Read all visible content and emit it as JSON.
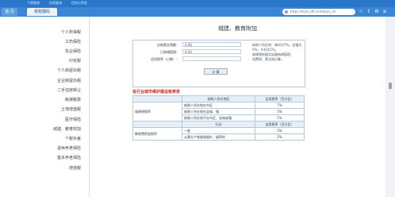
{
  "topbar": {
    "menu": [
      "个税查询",
      "社保查询",
      "住房公积金"
    ]
  },
  "tabs": {
    "home": "首 页",
    "active": "报税器码"
  },
  "address": {
    "text": "https://bszs.yffi.com/bszs_sh"
  },
  "sidebar": {
    "items": [
      "个人所得税",
      "工伤保险",
      "失业保险",
      "印花税",
      "个人房屋出租",
      "企业房屋出租",
      "二手住房转让",
      "耗煤税费",
      "土地增值税",
      "医疗保险",
      "城建、教育附加",
      "个税补差",
      "退休养老保险",
      "基本养老保险",
      "增值税"
    ]
  },
  "main": {
    "title": "城建、教育附加",
    "form": {
      "fields": [
        {
          "label": "应纳营业税额：",
          "value": "0.00"
        },
        {
          "label": "已纳增值税：",
          "value": "0.00"
        },
        {
          "label": "适用税率（小数）：",
          "value": ""
        }
      ],
      "notes": [
        "纳税人所在地：城市为7%，县镇为5%，乡村为1%。",
        "城建税依据实际缴纳增值税、",
        "消费税、营业税计算。"
      ],
      "button": "计 算"
    },
    "section_title": "各行业城市维护建设税率表",
    "table1": {
      "headers": [
        "纳税人所在地区",
        "适用税率（百分比）"
      ],
      "row_label": "城建税税率",
      "rows": [
        [
          "纳税人所在地在市区",
          "7%"
        ],
        [
          "纳税人所在地在县城、镇",
          "5%"
        ],
        [
          "纳税人所在地不在市区、县城或镇",
          "1%"
        ]
      ]
    },
    "table2": {
      "headers": [
        "行业",
        "适用税率（百分比）"
      ],
      "row_label": "教育费附加税率",
      "rows": [
        [
          "一般",
          "3%"
        ],
        [
          "从事生产卷烟和烟叶、烟草的",
          "2%"
        ]
      ]
    }
  }
}
